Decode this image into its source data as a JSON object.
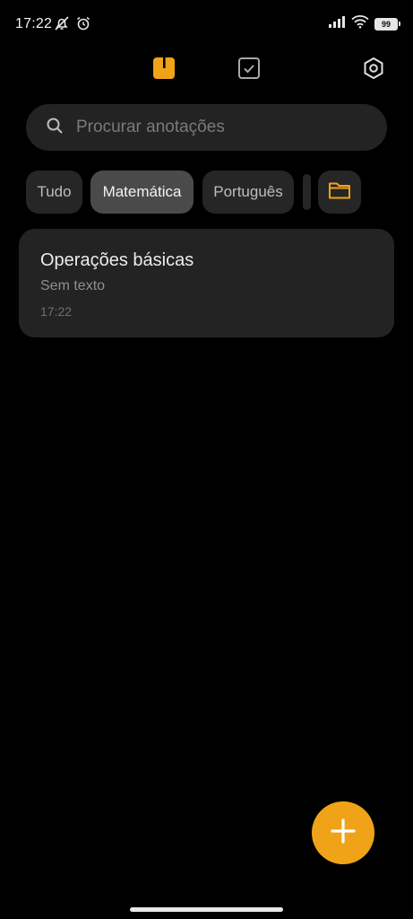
{
  "status_bar": {
    "time": "17:22",
    "battery": "99",
    "icons": [
      "muted-bell-icon",
      "alarm-icon",
      "signal-icon",
      "wifi-icon",
      "battery-icon"
    ]
  },
  "top_tabs": [
    {
      "name": "notes",
      "icon": "note-icon",
      "active": true
    },
    {
      "name": "tasks",
      "icon": "checkbox-icon",
      "active": false
    }
  ],
  "settings": {
    "icon": "gear-icon"
  },
  "search": {
    "placeholder": "Procurar anotações",
    "value": ""
  },
  "folders": {
    "items": [
      {
        "label": "Tudo",
        "active": false
      },
      {
        "label": "Matemática",
        "active": true
      },
      {
        "label": "Português",
        "active": false
      }
    ],
    "manage_icon": "folder-icon"
  },
  "notes": [
    {
      "title": "Operações básicas",
      "preview": "Sem texto",
      "time": "17:22"
    }
  ],
  "fab": {
    "icon": "plus-icon"
  },
  "colors": {
    "accent": "#f0a318",
    "background": "#000000",
    "card": "#232323",
    "chip_active": "#4a4a4a"
  }
}
